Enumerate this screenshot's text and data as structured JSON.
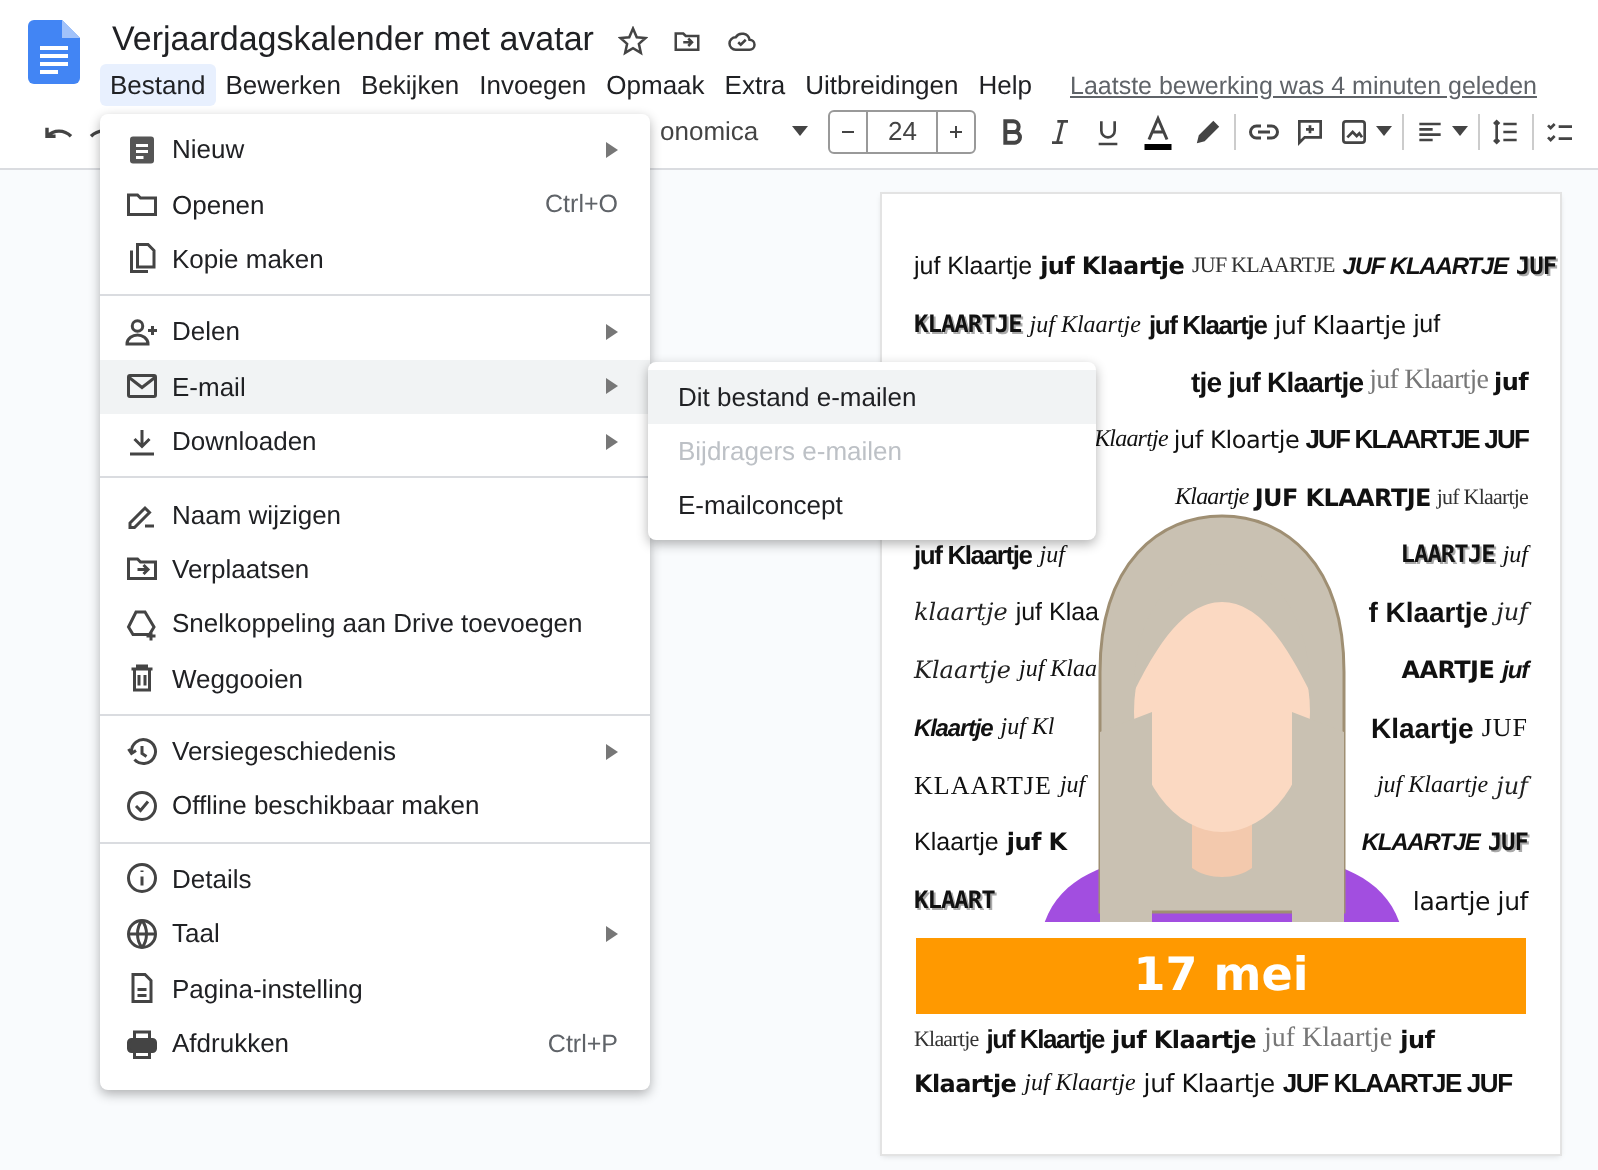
{
  "title": "Verjaardagskalender met avatar",
  "menubar": [
    {
      "label": "Bestand",
      "selected": true
    },
    {
      "label": "Bewerken",
      "selected": false
    },
    {
      "label": "Bekijken",
      "selected": false
    },
    {
      "label": "Invoegen",
      "selected": false
    },
    {
      "label": "Opmaak",
      "selected": false
    },
    {
      "label": "Extra",
      "selected": false
    },
    {
      "label": "Uitbreidingen",
      "selected": false
    },
    {
      "label": "Help",
      "selected": false
    }
  ],
  "last_edit": "Laatste bewerking was 4 minuten geleden",
  "toolbar": {
    "font": "onomica",
    "font_size": "24"
  },
  "file_menu": [
    [
      {
        "label": "Nieuw",
        "submenu": true,
        "selected": false
      },
      {
        "label": "Openen",
        "shortcut": "Ctrl+O",
        "selected": false
      },
      {
        "label": "Kopie maken",
        "selected": false
      }
    ],
    [
      {
        "label": "Delen",
        "submenu": true,
        "selected": false
      },
      {
        "label": "E-mail",
        "submenu": true,
        "selected": true
      },
      {
        "label": "Downloaden",
        "submenu": true,
        "selected": false
      }
    ],
    [
      {
        "label": "Naam wijzigen",
        "selected": false
      },
      {
        "label": "Verplaatsen",
        "selected": false
      },
      {
        "label": "Snelkoppeling aan Drive toevoegen",
        "selected": false
      },
      {
        "label": "Weggooien",
        "selected": false
      }
    ],
    [
      {
        "label": "Versiegeschiedenis",
        "submenu": true,
        "selected": false
      },
      {
        "label": "Offline beschikbaar maken",
        "selected": false
      }
    ],
    [
      {
        "label": "Details",
        "selected": false
      },
      {
        "label": "Taal",
        "submenu": true,
        "selected": false
      },
      {
        "label": "Pagina-instelling",
        "selected": false
      },
      {
        "label": "Afdrukken",
        "shortcut": "Ctrl+P",
        "selected": false
      }
    ]
  ],
  "email_submenu": [
    {
      "label": "Dit bestand e-mailen",
      "selected": true,
      "disabled": false
    },
    {
      "label": "Bijdragers e-mailen",
      "selected": false,
      "disabled": true
    },
    {
      "label": "E-mailconcept",
      "selected": false,
      "disabled": false
    }
  ],
  "document": {
    "lines": [
      {
        "left": [
          {
            "text": "juf Klaartje",
            "kind": "light"
          },
          {
            "text": "juf Klaartje",
            "kind": "heavy"
          },
          {
            "text": "JUF KLAARTJE",
            "kind": "thin"
          },
          {
            "text": "JUF KLAARTJE",
            "kind": "bolditalic"
          },
          {
            "text": "JUF",
            "kind": "outline"
          }
        ]
      },
      {
        "left": [
          {
            "text": "KLAARTJE",
            "kind": "outline"
          },
          {
            "text": "juf Klaartje",
            "kind": "script"
          },
          {
            "text": "juf Klaartje",
            "kind": "boldcond"
          },
          {
            "text": "juf Klaartje",
            "kind": "rounded"
          },
          {
            "text": "juf",
            "kind": "light"
          }
        ]
      },
      {
        "right": [
          {
            "text": "tje juf Klaartje",
            "kind": "bold"
          },
          {
            "text": "juf Klaartje",
            "kind": "serif"
          },
          {
            "text": "juf",
            "kind": "heavy"
          }
        ]
      },
      {
        "right": [
          {
            "text": "Klaartje",
            "kind": "script"
          },
          {
            "text": "juf Kloartje",
            "kind": "rounded"
          },
          {
            "text": "JUF KLAARTJE JUF",
            "kind": "boldcond"
          }
        ]
      },
      {
        "right": [
          {
            "text": "Klaartje",
            "kind": "script"
          },
          {
            "text": "JUF KLAARTJE",
            "kind": "heavy"
          },
          {
            "text": "juf Klaartje",
            "kind": "thin"
          }
        ]
      },
      {
        "left": [
          {
            "text": "juf Klaartje",
            "kind": "boldcond"
          },
          {
            "text": "juf",
            "kind": "script"
          }
        ],
        "right": [
          {
            "text": "LAARTJE",
            "kind": "outline"
          },
          {
            "text": "juf",
            "kind": "script"
          }
        ]
      },
      {
        "left": [
          {
            "text": "klaartje",
            "kind": "hand"
          },
          {
            "text": "juf Klaa",
            "kind": "light"
          }
        ],
        "right": [
          {
            "text": "f Klaartje",
            "kind": "bold"
          },
          {
            "text": "juf",
            "kind": "hand"
          }
        ]
      },
      {
        "left": [
          {
            "text": "Klaartje",
            "kind": "hand"
          },
          {
            "text": "juf Klaa",
            "kind": "script"
          }
        ],
        "right": [
          {
            "text": "AARTJE",
            "kind": "heavy"
          },
          {
            "text": "juf",
            "kind": "bolditalic"
          }
        ]
      },
      {
        "left": [
          {
            "text": "Klaartje",
            "kind": "bolditalic"
          },
          {
            "text": "juf Kl",
            "kind": "script"
          }
        ],
        "right": [
          {
            "text": "Klaartje",
            "kind": "bold"
          },
          {
            "text": "JUF",
            "kind": "serifcaps"
          }
        ]
      },
      {
        "left": [
          {
            "text": "KLAARTJE",
            "kind": "serifcaps"
          },
          {
            "text": "juf",
            "kind": "script"
          }
        ],
        "right": [
          {
            "text": "juf Klaartje",
            "kind": "script"
          },
          {
            "text": "juf",
            "kind": "hand"
          }
        ]
      },
      {
        "left": [
          {
            "text": "Klaartje",
            "kind": "light"
          },
          {
            "text": "juf K",
            "kind": "heavy"
          }
        ],
        "right": [
          {
            "text": "KLAARTJE",
            "kind": "bolditalic"
          },
          {
            "text": "JUF",
            "kind": "outline"
          }
        ]
      },
      {
        "left": [
          {
            "text": "KLAART",
            "kind": "outline"
          }
        ],
        "right": [
          {
            "text": "laartje juf",
            "kind": "rounded"
          }
        ]
      }
    ],
    "banner": "17 mei",
    "lines_after": [
      {
        "left": [
          {
            "text": "Klaartje",
            "kind": "thin"
          },
          {
            "text": "juf Klaartje",
            "kind": "boldcond"
          },
          {
            "text": "juf Klaartje",
            "kind": "heavy"
          },
          {
            "text": "juf Klaartje",
            "kind": "serif"
          },
          {
            "text": "juf",
            "kind": "heavy"
          }
        ]
      },
      {
        "left": [
          {
            "text": "Klaartje",
            "kind": "heavy"
          },
          {
            "text": "juf Klaartje",
            "kind": "script"
          },
          {
            "text": "juf Klaartje",
            "kind": "rounded"
          },
          {
            "text": "JUF KLAARTJE JUF",
            "kind": "boldcond"
          }
        ]
      }
    ]
  }
}
